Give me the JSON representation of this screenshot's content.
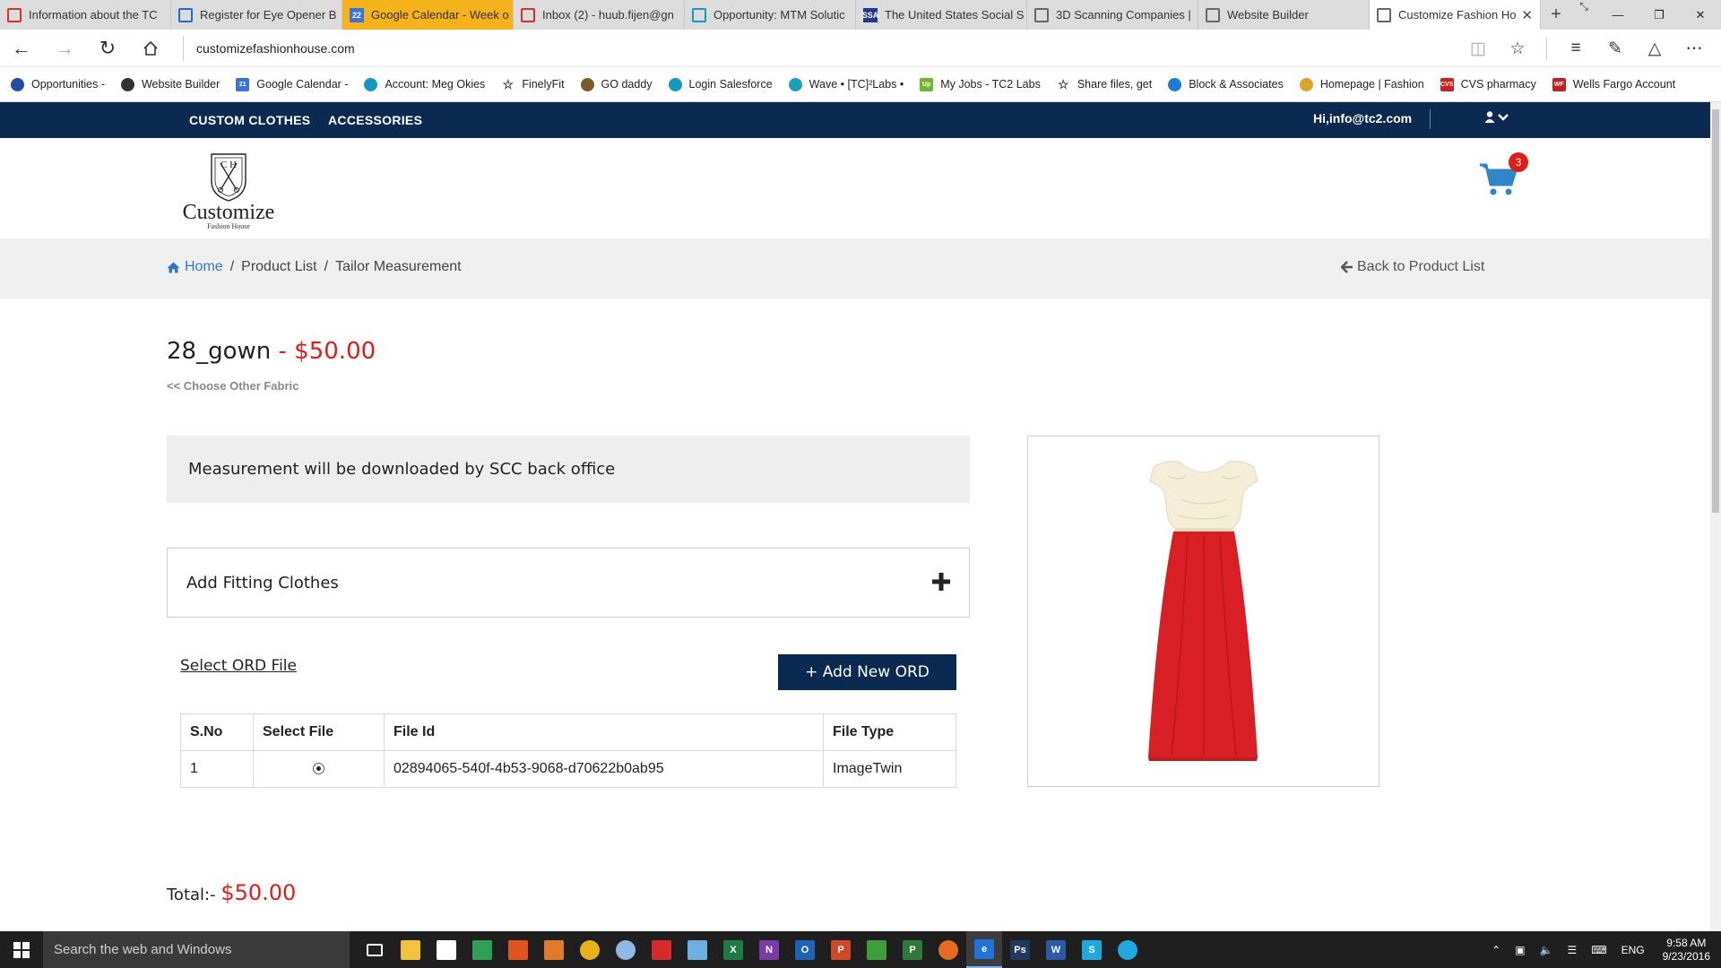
{
  "browser": {
    "tabs": [
      {
        "label": "Information about the TC",
        "icon": "gmail-icon",
        "color": "#d93025"
      },
      {
        "label": "Register for Eye Opener B",
        "icon": "edit-icon",
        "color": "#1e6bd6"
      },
      {
        "label": "Google Calendar - Week o",
        "icon": "calendar-icon",
        "color": "#3b73d9",
        "icon_text": "22"
      },
      {
        "label": "Inbox (2) - huub.fijen@gn",
        "icon": "gmail-icon",
        "color": "#d93025"
      },
      {
        "label": "Opportunity: MTM Solutic",
        "icon": "salesforce-cloud-icon",
        "color": "#1798c1"
      },
      {
        "label": "The United States Social S",
        "icon": "ssa-icon",
        "color": "#1f3a8a",
        "icon_text": "SSA"
      },
      {
        "label": "3D Scanning Companies |",
        "icon": "page-icon",
        "color": "#666666"
      },
      {
        "label": "Website Builder",
        "icon": "page-icon",
        "color": "#666666"
      },
      {
        "label": "Customize Fashion Ho",
        "icon": "page-icon",
        "color": "#666666"
      }
    ],
    "address": "customizefashionhouse.com",
    "favorites": [
      {
        "label": "Opportunities -",
        "icon": "star-box-icon",
        "color": "#1f4ea1"
      },
      {
        "label": "Website Builder",
        "icon": "globe-icon",
        "color": "#333333"
      },
      {
        "label": "Google Calendar -",
        "icon": "calendar-icon",
        "color": "#3b73d9",
        "icon_text": "21"
      },
      {
        "label": "Account: Meg Okies",
        "icon": "salesforce-cloud-icon",
        "color": "#1798c1"
      },
      {
        "label": "FinelyFit",
        "icon": "star-outline-icon",
        "color": "#444444"
      },
      {
        "label": "GO daddy",
        "icon": "godaddy-icon",
        "color": "#7a5b2e"
      },
      {
        "label": "Login  Salesforce",
        "icon": "salesforce-cloud-icon",
        "color": "#1798c1"
      },
      {
        "label": "Wave • [TC]²Labs •",
        "icon": "wave-icon",
        "color": "#1aa0b8"
      },
      {
        "label": "My Jobs - TC2 Labs",
        "icon": "upwork-icon",
        "color": "#6fb52c",
        "icon_text": "Up"
      },
      {
        "label": "Share files, get",
        "icon": "star-outline-icon",
        "color": "#444444"
      },
      {
        "label": "Block & Associates",
        "icon": "block-icon",
        "color": "#1f7ad6"
      },
      {
        "label": "Homepage | Fashion",
        "icon": "fashion-icon",
        "color": "#d9a52a"
      },
      {
        "label": "CVS pharmacy",
        "icon": "cvs-icon",
        "color": "#cc1f1f",
        "icon_text": "CVS"
      },
      {
        "label": "Wells Fargo Account",
        "icon": "wellsfargo-icon",
        "color": "#c61f1f",
        "icon_text": "WF"
      }
    ]
  },
  "site": {
    "menu": [
      "CUSTOM CLOTHES",
      "ACCESSORIES"
    ],
    "user_greeting": "Hi,info@tc2.com",
    "logo": {
      "text": "Customize",
      "sub": "Fashion House",
      "monogram": "C H"
    },
    "cart_count": "3",
    "breadcrumb": {
      "home": "Home",
      "product_list": "Product List",
      "current": "Tailor Measurement",
      "sep": "/"
    },
    "back_link": "Back to Product List",
    "product": {
      "name": "28_gown",
      "dash": " - ",
      "price": "$50.00"
    },
    "choose_fabric": "<< Choose Other Fabric",
    "measurement_note": "Measurement will be downloaded by SCC back office",
    "add_fitting": "Add Fitting Clothes",
    "select_ord": "Select ORD File",
    "add_ord_button": "+ Add New ORD",
    "table": {
      "headers": [
        "S.No",
        "Select File",
        "File Id",
        "File Type"
      ],
      "rows": [
        {
          "sno": "1",
          "selected": true,
          "file_id": "02894065-540f-4b53-9068-d70622b0ab95",
          "file_type": "ImageTwin"
        }
      ]
    },
    "total_label": "Total:-",
    "total_price": "$50.00"
  },
  "taskbar": {
    "search_placeholder": "Search the web and Windows",
    "apps": [
      {
        "icon": "task-view-icon",
        "color": "#1f1f1f"
      },
      {
        "icon": "file-explorer-icon",
        "color": "#f2c23a"
      },
      {
        "icon": "store-icon",
        "color": "#ffffff"
      },
      {
        "icon": "photos-icon",
        "color": "#2f9e57"
      },
      {
        "icon": "power-icon",
        "color": "#e0541f"
      },
      {
        "icon": "package-icon",
        "color": "#e07a2a"
      },
      {
        "icon": "chrome-icon",
        "color": "#e8b21b"
      },
      {
        "icon": "gear-app-icon",
        "color": "#8fb7e8"
      },
      {
        "icon": "acrobat-icon",
        "color": "#d62b2b"
      },
      {
        "icon": "paint-icon",
        "color": "#6bb0e0"
      },
      {
        "icon": "excel-icon",
        "color": "#1e7b45",
        "icon_text": "X"
      },
      {
        "icon": "onenote-icon",
        "color": "#7a3aa8",
        "icon_text": "N"
      },
      {
        "icon": "outlook-icon",
        "color": "#1e63b5",
        "icon_text": "O"
      },
      {
        "icon": "powerpoint-icon",
        "color": "#d24726",
        "icon_text": "P"
      },
      {
        "icon": "camtasia-icon",
        "color": "#3d9e3d"
      },
      {
        "icon": "project-icon",
        "color": "#2f7a3a",
        "icon_text": "P"
      },
      {
        "icon": "firefox-icon",
        "color": "#e66a1f"
      },
      {
        "icon": "edge-icon",
        "color": "#1f74d6",
        "icon_text": "e"
      },
      {
        "icon": "photoshop-icon",
        "color": "#1f3a5e",
        "icon_text": "Ps"
      },
      {
        "icon": "word-icon",
        "color": "#2a5aa8",
        "icon_text": "W"
      },
      {
        "icon": "skype-icon",
        "color": "#1fa8e0",
        "icon_text": "S"
      },
      {
        "icon": "skype-alt-icon",
        "color": "#1fa8e0"
      }
    ],
    "language": "ENG",
    "time": "9:58 AM",
    "date": "9/23/2016"
  }
}
